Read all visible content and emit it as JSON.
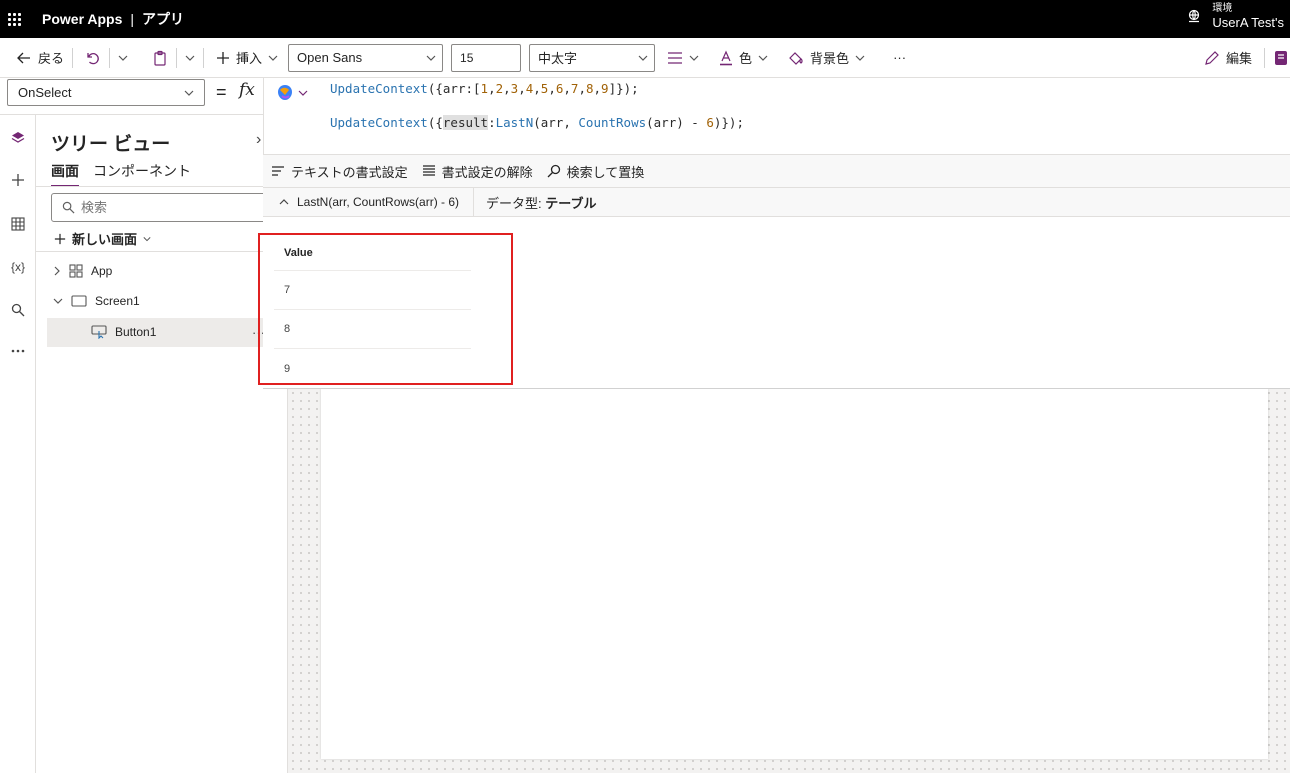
{
  "topbar": {
    "product": "Power Apps",
    "separator": "|",
    "app_label": "アプリ",
    "env_label": "環境",
    "env_name": "UserA Test's"
  },
  "commandbar": {
    "back": "戻る",
    "insert": "挿入",
    "font": "Open Sans",
    "font_size": "15",
    "font_weight": "中太字",
    "color": "色",
    "fill": "背景色",
    "more": "···",
    "edit": "編集"
  },
  "formulabar": {
    "property": "OnSelect",
    "equals": "=",
    "fx": "fx"
  },
  "editor": {
    "line1": {
      "p1": "UpdateContext",
      "p2": "({arr:[",
      "nums": [
        "1",
        "2",
        "3",
        "4",
        "5",
        "6",
        "7",
        "8",
        "9"
      ],
      "p3": "]});"
    },
    "line2": {
      "fn": "UpdateContext",
      "open": "({",
      "var": "result",
      "colon": ":",
      "fn2": "LastN",
      "args_a": "(arr, ",
      "fn3": "CountRows",
      "args_b": "(arr) - ",
      "num": "6",
      "close": ")});"
    }
  },
  "editor_toolbar": {
    "format_text": "テキストの書式設定",
    "remove_format": "書式設定の解除",
    "find_replace": "検索して置換"
  },
  "result": {
    "expression": "LastN(arr, CountRows(arr) - 6)",
    "type_label": "データ型:",
    "type_value": "テーブル",
    "column": "Value",
    "rows": [
      "7",
      "8",
      "9"
    ]
  },
  "tree": {
    "title": "ツリー ビュー",
    "tabs": [
      "画面",
      "コンポーネント"
    ],
    "search_placeholder": "検索",
    "new_screen": "新しい画面",
    "nodes": {
      "app": "App",
      "screen": "Screen1",
      "button": "Button1"
    }
  },
  "rail": {
    "variables": "{x}"
  },
  "colors": {
    "accent": "#742774",
    "highlight_box": "#e02020",
    "function": "#2a73b0",
    "number": "#a16207"
  }
}
